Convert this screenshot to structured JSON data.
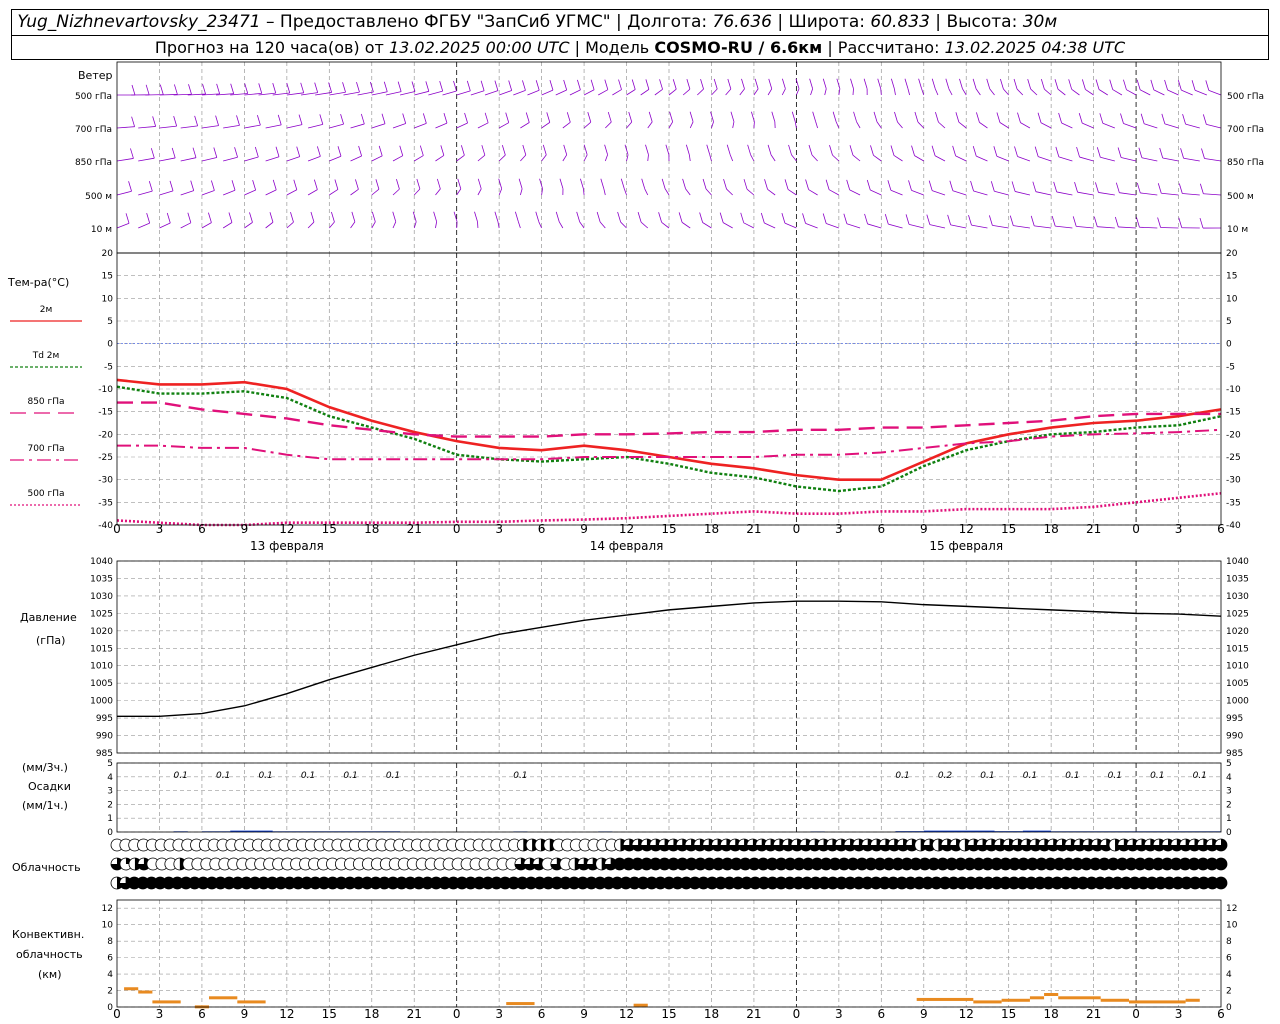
{
  "header": {
    "station": "Yug_Nizhnevartovsky_23471",
    "provider": "– Предоставлено ФГБУ \"ЗапСиб УГМС\"",
    "lon_label": "Долгота:",
    "lon": "76.636",
    "lat_label": "Широта:",
    "lat": "60.833",
    "alt_label": "Высота:",
    "alt": "30м",
    "forecast_label": "Прогноз на 120 часа(ов) от",
    "forecast_start": "13.02.2025 00:00 UTC",
    "model_label": "| Модель",
    "model": "COSMO-RU / 6.6км",
    "calc_label": "| Рассчитано:",
    "calc_time": "13.02.2025 04:38 UTC"
  },
  "panels": {
    "wind": {
      "title": "Ветер",
      "levels": [
        "500 гПа",
        "700 гПа",
        "850 гПа",
        "500 м",
        "10 м"
      ]
    },
    "temp": {
      "title": "Тем-ра(°С)",
      "legend": [
        "2м",
        "Td 2м",
        "850 гПа",
        "700 гПа",
        "500 гПа"
      ]
    },
    "pressure": {
      "title": "Давление",
      "unit": "(гПа)"
    },
    "precip": {
      "title1": "(мм/3ч.)",
      "title2": "Осадки",
      "title3": "(мм/1ч.)"
    },
    "cloud": {
      "title": "Облачность"
    },
    "conv": {
      "title1": "Конвективн.",
      "title2": "облачность",
      "title3": "(км)"
    }
  },
  "x_ticks": [
    "0",
    "3",
    "6",
    "9",
    "12",
    "15",
    "18",
    "21",
    "0",
    "3",
    "6",
    "9",
    "12",
    "15",
    "18",
    "21",
    "0",
    "3",
    "6",
    "9",
    "12",
    "15",
    "18",
    "21",
    "0",
    "3",
    "6"
  ],
  "dates": [
    "13 февраля",
    "14 февраля",
    "15 февраля"
  ],
  "colors": {
    "wind": "#8b00c8",
    "t2m": "#ee2222",
    "td": "#108010",
    "t850": "#e0107a",
    "t700": "#e0107a",
    "t500": "#e0107a",
    "pressure": "#000000",
    "precip": "#1040d0",
    "conv": "#e88a20",
    "grid": "#999999"
  },
  "chart_data": [
    {
      "type": "line",
      "title": "Тем-ра(°С)",
      "x_hours": [
        0,
        3,
        6,
        9,
        12,
        15,
        18,
        21,
        24,
        27,
        30,
        33,
        36,
        39,
        42,
        45,
        48,
        51,
        54,
        57,
        60,
        63,
        66,
        69,
        72,
        75,
        78
      ],
      "ylim": [
        -40,
        20
      ],
      "yticks": [
        20,
        15,
        10,
        5,
        0,
        -5,
        -10,
        -15,
        -20,
        -25,
        -30,
        -35,
        -40
      ],
      "series": [
        {
          "name": "2м",
          "values": [
            -8,
            -9,
            -9,
            -8.5,
            -10,
            -14,
            -17,
            -19.5,
            -21.5,
            -23,
            -23.5,
            -22.5,
            -23.5,
            -25,
            -26.5,
            -27.5,
            -29,
            -30,
            -30,
            -26,
            -22,
            -20,
            -18.5,
            -17.5,
            -17,
            -16,
            -14.5
          ]
        },
        {
          "name": "Td 2м",
          "values": [
            -9.5,
            -11,
            -11,
            -10.5,
            -12,
            -16,
            -18.5,
            -21,
            -24.5,
            -25.5,
            -26,
            -25.5,
            -25,
            -26.5,
            -28.5,
            -29.5,
            -31.5,
            -32.5,
            -31.5,
            -27,
            -23.5,
            -21.5,
            -20,
            -19.5,
            -18.5,
            -18,
            -16
          ]
        },
        {
          "name": "850 гПа",
          "values": [
            -13,
            -13,
            -14.5,
            -15.5,
            -16.5,
            -18,
            -19,
            -20,
            -20.5,
            -20.5,
            -20.5,
            -20,
            -20,
            -19.8,
            -19.5,
            -19.5,
            -19,
            -19,
            -18.5,
            -18.5,
            -18,
            -17.5,
            -17,
            -16,
            -15.5,
            -15.5,
            -15.5
          ]
        },
        {
          "name": "700 гПа",
          "values": [
            -22.5,
            -22.5,
            -23,
            -23,
            -24.5,
            -25.5,
            -25.5,
            -25.5,
            -25.5,
            -25.5,
            -25.5,
            -25,
            -25,
            -25,
            -25,
            -25,
            -24.5,
            -24.5,
            -24,
            -23,
            -22,
            -21.5,
            -20.5,
            -20,
            -19.8,
            -19.5,
            -19
          ]
        },
        {
          "name": "500 гПа",
          "values": [
            -39,
            -39.5,
            -40,
            -40,
            -39.5,
            -39.5,
            -39.5,
            -39.5,
            -39.3,
            -39.3,
            -39,
            -38.8,
            -38.5,
            -38,
            -37.5,
            -37,
            -37.5,
            -37.5,
            -37,
            -37,
            -36.5,
            -36.5,
            -36.5,
            -36,
            -35,
            -34,
            -33
          ]
        }
      ]
    },
    {
      "type": "line",
      "title": "Давление",
      "ylabel": "(гПа)",
      "ylim": [
        985,
        1040
      ],
      "yticks": [
        1040,
        1035,
        1030,
        1025,
        1020,
        1015,
        1010,
        1005,
        1000,
        995,
        990,
        985
      ],
      "x_hours": [
        0,
        3,
        6,
        9,
        12,
        15,
        18,
        21,
        24,
        27,
        30,
        33,
        36,
        39,
        42,
        45,
        48,
        51,
        54,
        57,
        60,
        63,
        66,
        69,
        72,
        75,
        78
      ],
      "series": [
        {
          "values": [
            995.5,
            995.5,
            996.3,
            998.5,
            1002,
            1006,
            1009.5,
            1013,
            1016,
            1019,
            1021,
            1023,
            1024.5,
            1026,
            1027,
            1028,
            1028.5,
            1028.5,
            1028.3,
            1027.5,
            1027,
            1026.5,
            1026,
            1025.5,
            1025,
            1024.8,
            1024.2
          ]
        }
      ]
    },
    {
      "type": "bar",
      "title": "Осадки",
      "ylim": [
        0,
        5
      ],
      "yticks": [
        5,
        4,
        3,
        2,
        1,
        0
      ],
      "labels_3h": [
        {
          "hour": 4.5,
          "text": "0.1"
        },
        {
          "hour": 7.5,
          "text": "0.1"
        },
        {
          "hour": 10.5,
          "text": "0.1"
        },
        {
          "hour": 13.5,
          "text": "0.1"
        },
        {
          "hour": 16.5,
          "text": "0.1"
        },
        {
          "hour": 19.5,
          "text": "0.1"
        },
        {
          "hour": 28.5,
          "text": "0.1"
        },
        {
          "hour": 55.5,
          "text": "0.1"
        },
        {
          "hour": 58.5,
          "text": "0.2"
        },
        {
          "hour": 61.5,
          "text": "0.1"
        },
        {
          "hour": 64.5,
          "text": "0.1"
        },
        {
          "hour": 67.5,
          "text": "0.1"
        },
        {
          "hour": 70.5,
          "text": "0.1"
        },
        {
          "hour": 73.5,
          "text": "0.1"
        },
        {
          "hour": 76.5,
          "text": "0.1"
        }
      ],
      "bars_1h": [
        {
          "from": 4,
          "to": 5,
          "value": 0.05
        },
        {
          "from": 6,
          "to": 8,
          "value": 0.05
        },
        {
          "from": 8,
          "to": 11,
          "value": 0.1
        },
        {
          "from": 11,
          "to": 20,
          "value": 0.05
        },
        {
          "from": 28,
          "to": 29,
          "value": 0.04
        },
        {
          "from": 34,
          "to": 35,
          "value": 0.04
        },
        {
          "from": 49,
          "to": 50,
          "value": 0.04
        },
        {
          "from": 55,
          "to": 57,
          "value": 0.06
        },
        {
          "from": 57,
          "to": 62,
          "value": 0.1
        },
        {
          "from": 62,
          "to": 64,
          "value": 0.06
        },
        {
          "from": 64,
          "to": 66,
          "value": 0.1
        },
        {
          "from": 66,
          "to": 78,
          "value": 0.05
        }
      ]
    },
    {
      "type": "table",
      "title": "Облачность",
      "rows": [
        {
          "cover": [
            "clear",
            "clear",
            "clear",
            "clear",
            "clear",
            "clear",
            "clear",
            "clear",
            "clear",
            "clear",
            "clear",
            "clear",
            "clear",
            "clear",
            "clear",
            "clear",
            "clear",
            "clear",
            "clear",
            "clear",
            "clear",
            "clear",
            "clear",
            "clear",
            "clear",
            "clear",
            "clear",
            "clear",
            "clear",
            "clear",
            "clear",
            "clear",
            "clear",
            "clear",
            "clear",
            "clear",
            "clear",
            "clear",
            "clear",
            "clear",
            "clear",
            "clear",
            "clear",
            "clear",
            "clear",
            "clear",
            "half",
            "half",
            "half",
            "half",
            "clear",
            "clear",
            "clear",
            "clear",
            "clear",
            "clear",
            "clear",
            "half",
            "three",
            "three",
            "three",
            "three",
            "three",
            "three",
            "three",
            "three",
            "three",
            "three",
            "three",
            "three",
            "three",
            "three",
            "three",
            "three",
            "three",
            "three",
            "three",
            "three",
            "three",
            "three",
            "three",
            "three",
            "three",
            "three",
            "three",
            "three",
            "three",
            "three",
            "three",
            "three",
            "three",
            "half",
            "three",
            "half",
            "three",
            "three",
            "half",
            "three",
            "three",
            "three",
            "three",
            "three",
            "three",
            "three",
            "three",
            "three",
            "three",
            "three",
            "three",
            "three",
            "three",
            "three",
            "three",
            "half",
            "three",
            "three",
            "three",
            "three",
            "three",
            "three",
            "three",
            "three",
            "three",
            "three",
            "three",
            "three"
          ]
        },
        {
          "cover": [
            "three",
            "quarter",
            "half",
            "three",
            "clear",
            "clear",
            "clear",
            "half",
            "clear",
            "clear",
            "clear",
            "clear",
            "clear",
            "clear",
            "clear",
            "clear",
            "clear",
            "clear",
            "clear",
            "clear",
            "clear",
            "clear",
            "clear",
            "clear",
            "clear",
            "clear",
            "clear",
            "clear",
            "clear",
            "clear",
            "clear",
            "clear",
            "clear",
            "clear",
            "clear",
            "clear",
            "clear",
            "clear",
            "clear",
            "clear",
            "clear",
            "clear",
            "clear",
            "clear",
            "clear",
            "three",
            "three",
            "three",
            "clear",
            "three",
            "clear",
            "half",
            "three",
            "three",
            "half",
            "three",
            "full",
            "full",
            "full",
            "full",
            "full",
            "full",
            "full",
            "full",
            "full",
            "full",
            "full",
            "full",
            "full",
            "full",
            "full",
            "full",
            "full",
            "full",
            "full",
            "full",
            "full",
            "full",
            "full",
            "full",
            "full",
            "full",
            "full",
            "full",
            "full",
            "full",
            "full",
            "full",
            "full",
            "full",
            "full",
            "full",
            "full",
            "full",
            "full",
            "full",
            "full",
            "full",
            "full",
            "full",
            "full",
            "full",
            "full",
            "full",
            "full",
            "full",
            "full",
            "full",
            "full",
            "full",
            "full",
            "full",
            "full",
            "full",
            "full",
            "full",
            "full",
            "full",
            "full",
            "full",
            "full",
            "full",
            "full",
            "full"
          ]
        },
        {
          "cover": [
            "half",
            "three",
            "full",
            "full",
            "full",
            "full",
            "full",
            "full",
            "full",
            "full",
            "full",
            "full",
            "full",
            "full",
            "full",
            "full",
            "full",
            "full",
            "full",
            "full",
            "full",
            "full",
            "full",
            "full",
            "full",
            "full",
            "full",
            "full",
            "full",
            "full",
            "full",
            "full",
            "full",
            "full",
            "full",
            "full",
            "full",
            "full",
            "full",
            "full",
            "full",
            "full",
            "full",
            "full",
            "full",
            "full",
            "full",
            "full",
            "full",
            "full",
            "full",
            "full",
            "full",
            "full",
            "full",
            "full",
            "full",
            "full",
            "full",
            "full",
            "full",
            "full",
            "full",
            "full",
            "full",
            "full",
            "full",
            "full",
            "full",
            "full",
            "full",
            "full",
            "full",
            "full",
            "full",
            "full",
            "full",
            "full",
            "full",
            "full",
            "full",
            "full",
            "full",
            "full",
            "full",
            "full",
            "full",
            "full",
            "full",
            "full",
            "full",
            "full",
            "full",
            "full",
            "full",
            "full",
            "full",
            "full",
            "full",
            "full",
            "full",
            "full",
            "full",
            "full",
            "full",
            "full",
            "full",
            "full",
            "full",
            "full",
            "full",
            "full",
            "full",
            "full",
            "full",
            "full",
            "full",
            "full",
            "full",
            "full",
            "full",
            "full",
            "full",
            "full",
            "full",
            "full",
            "full",
            "full",
            "full"
          ]
        }
      ]
    },
    {
      "type": "bar",
      "title": "Конвективн. облачность (км)",
      "ylim": [
        0,
        13
      ],
      "yticks": [
        12,
        10,
        8,
        6,
        4,
        2,
        0
      ],
      "segments": [
        {
          "from": 0.5,
          "to": 1.5,
          "top": 2.4
        },
        {
          "from": 1.5,
          "to": 2.5,
          "top": 2
        },
        {
          "from": 2.5,
          "to": 4.5,
          "top": 0.8
        },
        {
          "from": 5.5,
          "to": 6.5,
          "top": 0.2
        },
        {
          "from": 6.5,
          "to": 8.5,
          "top": 1.3
        },
        {
          "from": 8.5,
          "to": 10.5,
          "top": 0.8
        },
        {
          "from": 27.5,
          "to": 29.5,
          "top": 0.6
        },
        {
          "from": 36.5,
          "to": 37.5,
          "top": 0.4
        },
        {
          "from": 56.5,
          "to": 60.5,
          "top": 1.1
        },
        {
          "from": 60.5,
          "to": 62.5,
          "top": 0.8
        },
        {
          "from": 62.5,
          "to": 64.5,
          "top": 1
        },
        {
          "from": 64.5,
          "to": 65.5,
          "top": 1.3
        },
        {
          "from": 65.5,
          "to": 66.5,
          "top": 1.7
        },
        {
          "from": 66.5,
          "to": 69.5,
          "top": 1.3
        },
        {
          "from": 69.5,
          "to": 71.5,
          "top": 1
        },
        {
          "from": 71.5,
          "to": 75.5,
          "top": 0.8
        },
        {
          "from": 75.5,
          "to": 76.5,
          "top": 1
        }
      ]
    }
  ]
}
